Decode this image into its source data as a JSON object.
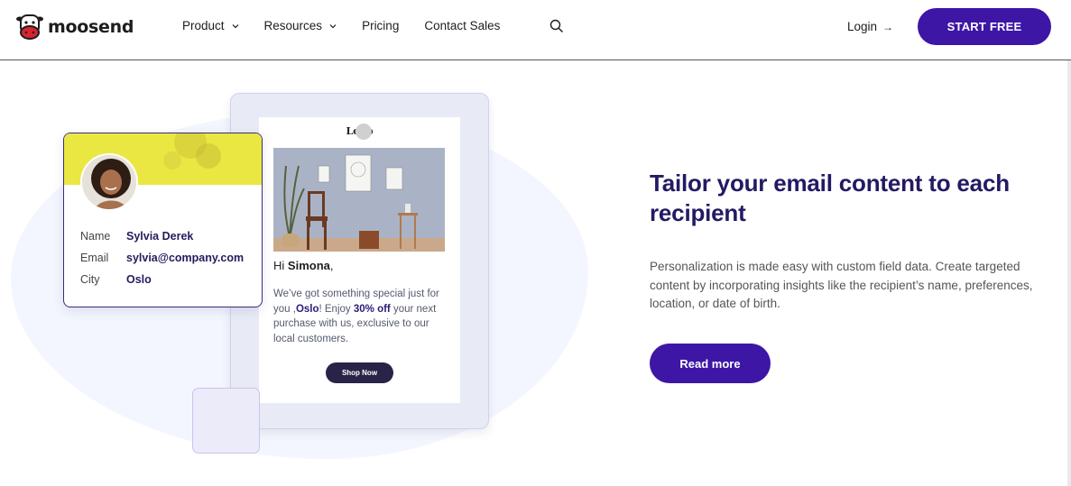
{
  "brand": {
    "name": "moosend",
    "accent": "#3d16a6",
    "headline_color": "#231a63"
  },
  "nav": {
    "items": [
      {
        "label": "Product",
        "has_dropdown": true
      },
      {
        "label": "Resources",
        "has_dropdown": true
      },
      {
        "label": "Pricing",
        "has_dropdown": false
      },
      {
        "label": "Contact Sales",
        "has_dropdown": false
      }
    ],
    "search_icon": "search-icon",
    "login_label": "Login",
    "login_arrow": "→",
    "cta_label": "START FREE"
  },
  "illustration": {
    "email": {
      "logo_text": "Logo",
      "greeting_prefix": "Hi",
      "greeting_name": "Simona",
      "greeting_suffix": ",",
      "body_1": "We’ve got something special just for you ,",
      "body_city": "Oslo",
      "body_2": "! Enjoy ",
      "body_offer": "30% off",
      "body_3": " your next purchase with us, exclusive to our local customers.",
      "button_label": "Shop Now"
    },
    "profile": {
      "name_label": "Name",
      "name_value": "Sylvia Derek",
      "email_label": "Email",
      "email_value": "sylvia@company.com",
      "city_label": "City",
      "city_value": "Oslo"
    }
  },
  "content": {
    "headline": "Tailor your email content to each recipient",
    "description": "Personalization is made easy with custom field data. Create targeted content by incorporating insights like the recipient’s name, preferences, location, or date of birth.",
    "cta_label": "Read more"
  }
}
